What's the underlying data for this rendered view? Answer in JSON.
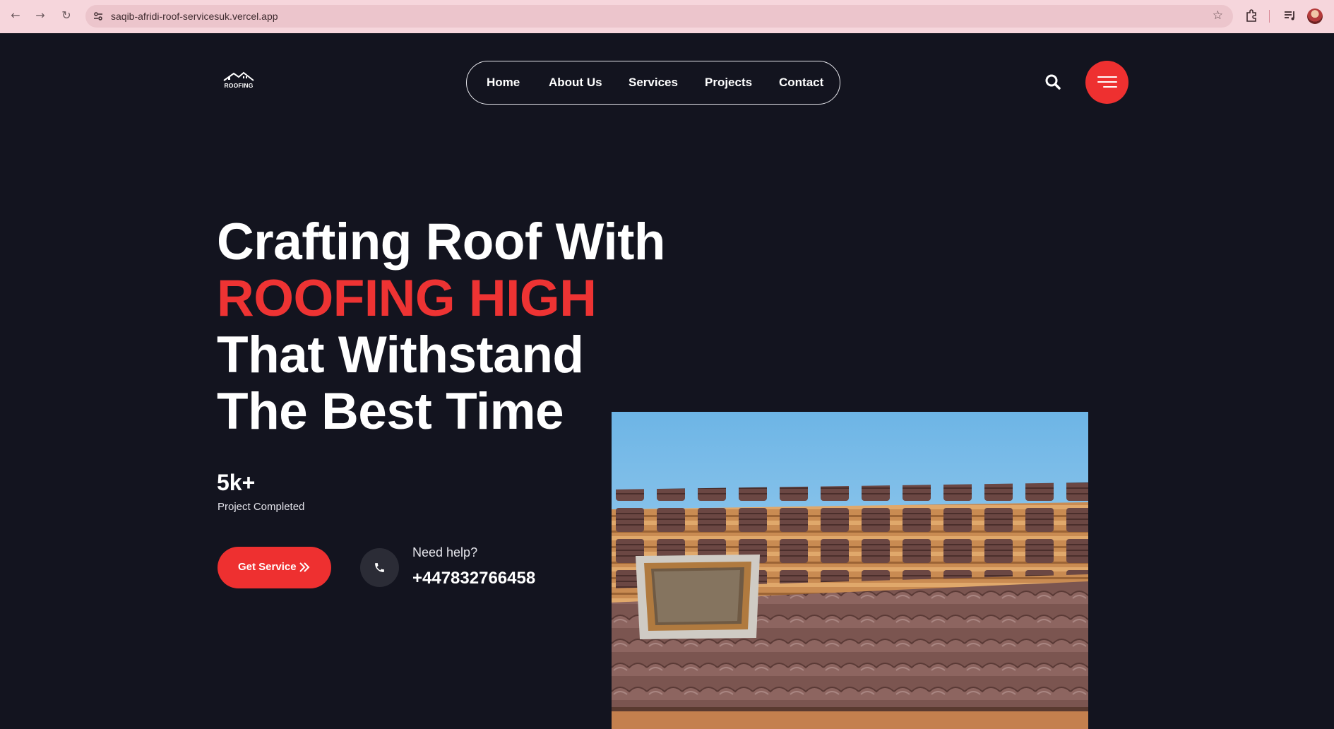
{
  "browser": {
    "url": "saqib-afridi-roof-servicesuk.vercel.app",
    "icons": [
      "back-icon",
      "forward-icon",
      "reload-icon",
      "site-settings-icon",
      "bookmark-star-icon",
      "extensions-icon",
      "media-controls-icon",
      "profile-avatar"
    ]
  },
  "header": {
    "logo_text": "ROOFING",
    "nav": [
      "Home",
      "About Us",
      "Services",
      "Projects",
      "Contact"
    ],
    "accent_color": "#ee3030"
  },
  "hero": {
    "title_line1": "Crafting Roof With",
    "title_line2": "ROOFING HIGH",
    "title_line3": "That Withstand",
    "title_line4": "The Best Time",
    "stat_value": "5k+",
    "stat_label": "Project Completed",
    "cta_label": "Get Service",
    "help_label": "Need help?",
    "help_phone": "+447832766458"
  },
  "colors": {
    "background": "#13141f",
    "accent": "#ee3030",
    "chrome": "#f6d6dc"
  }
}
